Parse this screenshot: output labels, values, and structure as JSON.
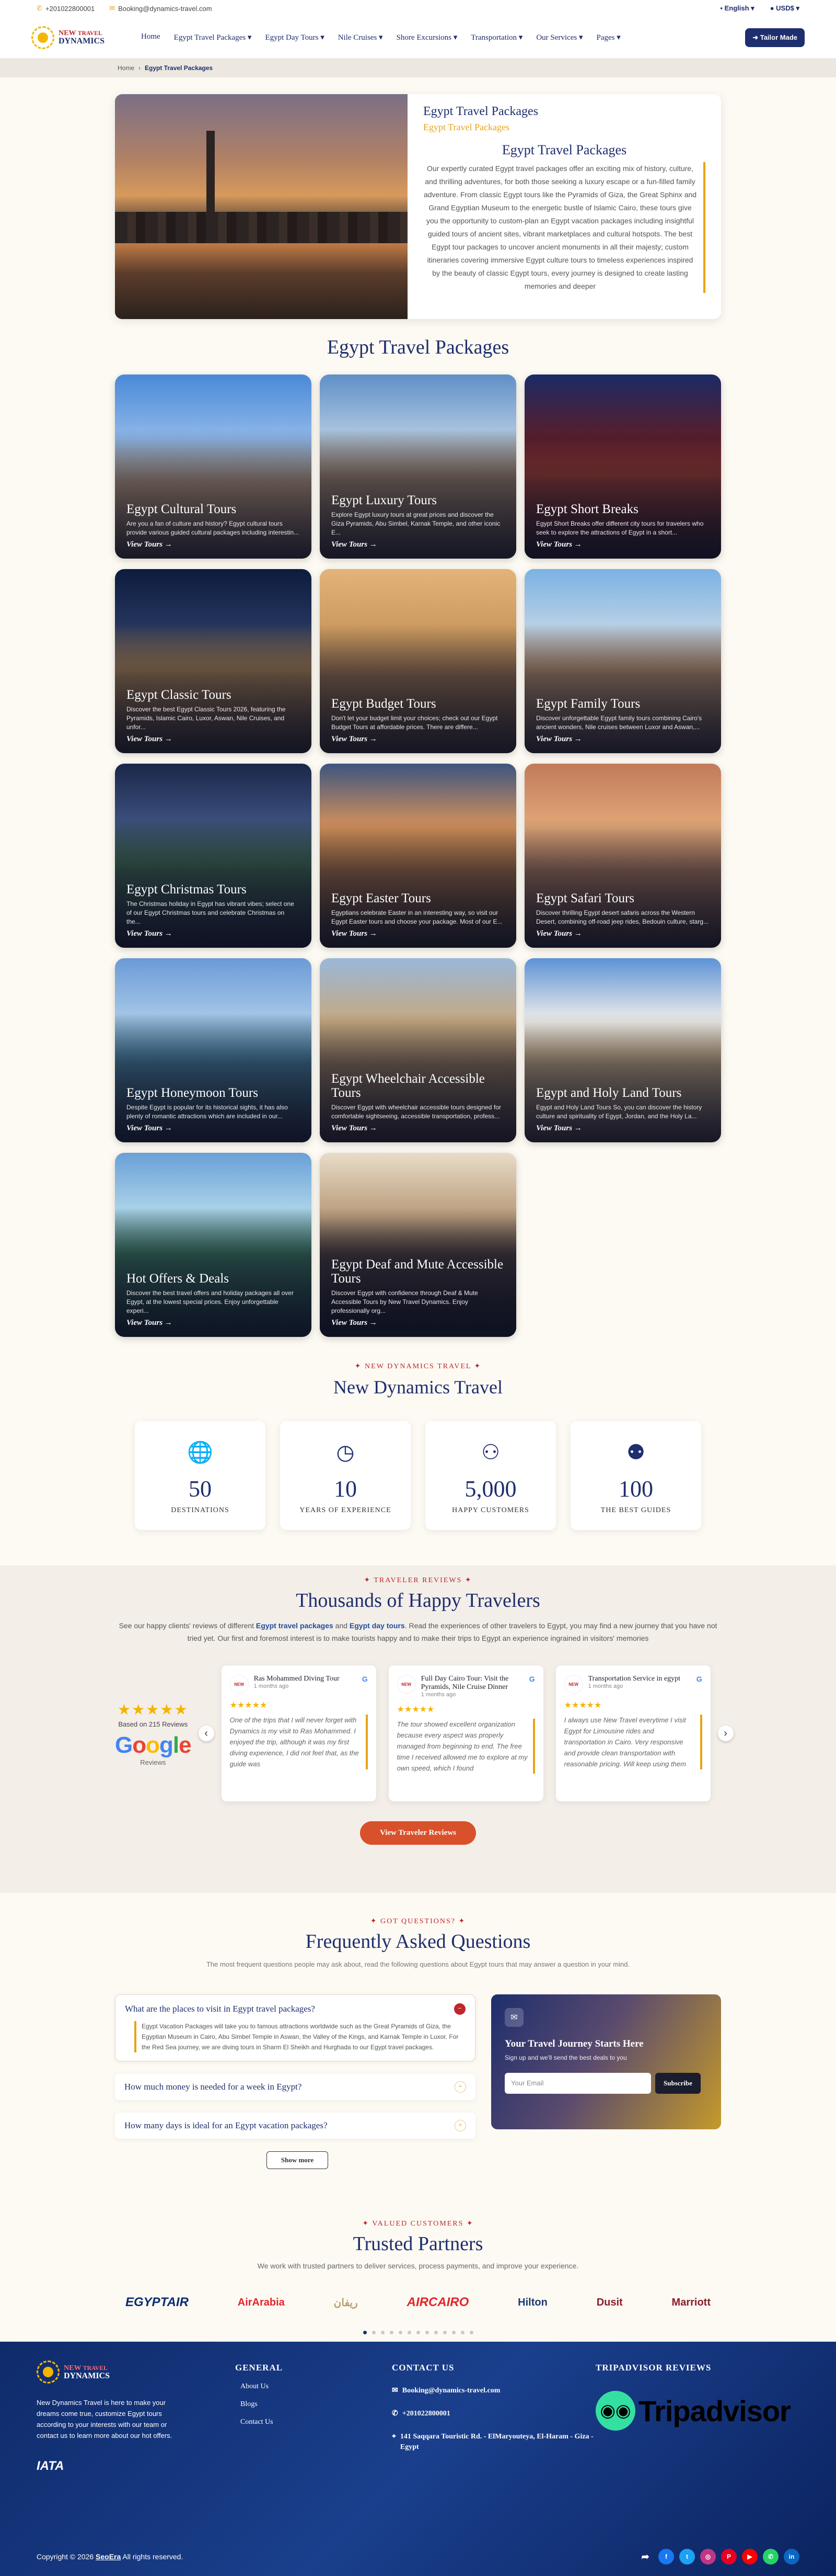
{
  "topbar": {
    "phone": "+201022800001",
    "email": "Booking@dynamics-travel.com",
    "language": "English",
    "currency": "USD$"
  },
  "logo": {
    "line1": "NEW",
    "line2": "TRAVEL",
    "line3": "DYNAMICS"
  },
  "nav": [
    "Home",
    "Egypt Travel Packages",
    "Egypt Day Tours",
    "Nile Cruises",
    "Shore Excursions",
    "Transportation",
    "Our Services",
    "Pages"
  ],
  "tailor_button": "Tailor Made",
  "breadcrumb": {
    "home": "Home",
    "current": "Egypt Travel Packages"
  },
  "intro": {
    "title": "Egypt Travel Packages",
    "subtitle": "Egypt Travel Packages",
    "heading": "Egypt Travel Packages",
    "text": "Our expertly curated Egypt travel packages offer an exciting mix of history, culture, and thrilling adventures, for both those seeking a luxury escape or a fun-filled family adventure. From classic Egypt tours like the Pyramids of Giza, the Great Sphinx and Grand Egyptian Museum to the energetic bustle of Islamic Cairo, these tours give you the opportunity to custom-plan an Egypt vacation packages including insightful guided tours of ancient sites, vibrant marketplaces and cultural hotspots. The best Egypt tour packages to uncover ancient monuments in all their majesty; custom itineraries covering immersive Egypt culture tours to timeless experiences inspired by the beauty of classic Egypt tours, every journey is designed to create lasting memories and deeper"
  },
  "packages_title": "Egypt Travel Packages",
  "view_label": "View Tours →",
  "packages": [
    {
      "title": "Egypt Cultural Tours",
      "desc": "Are you a fan of culture and history? Egypt cultural tours provide various guided cultural packages including interestin..."
    },
    {
      "title": "Egypt Luxury Tours",
      "desc": "Explore Egypt luxury tours at great prices and discover the Giza Pyramids, Abu Simbel, Karnak Temple, and other iconic E..."
    },
    {
      "title": "Egypt Short Breaks",
      "desc": "Egypt Short Breaks offer different city tours for travelers who seek to explore the attractions of Egypt in a short..."
    },
    {
      "title": "Egypt Classic Tours",
      "desc": "Discover the best Egypt Classic Tours 2026, featuring the Pyramids, Islamic Cairo, Luxor, Aswan, Nile Cruises, and unfor..."
    },
    {
      "title": "Egypt Budget Tours",
      "desc": "Don't let your budget limit your choices; check out our Egypt Budget Tours at affordable prices. There are differe..."
    },
    {
      "title": "Egypt Family Tours",
      "desc": "Discover unforgettable Egypt family tours combining Cairo's ancient wonders, Nile cruises between Luxor and Aswan,..."
    },
    {
      "title": "Egypt Christmas Tours",
      "desc": "The Christmas holiday in Egypt has vibrant vibes; select one of our Egypt Christmas tours and celebrate Christmas on the..."
    },
    {
      "title": "Egypt Easter Tours",
      "desc": "Egyptians celebrate Easter in an interesting way, so visit our Egypt Easter tours and choose your package. Most of our E..."
    },
    {
      "title": "Egypt Safari Tours",
      "desc": "Discover thrilling Egypt desert safaris across the Western Desert, combining off-road jeep rides, Bedouin culture, starg..."
    },
    {
      "title": "Egypt Honeymoon Tours",
      "desc": "Despite Egypt is popular for its historical sights, it has also plenty of romantic attractions which are included in our..."
    },
    {
      "title": "Egypt Wheelchair Accessible Tours",
      "desc": "Discover Egypt with wheelchair accessible tours designed for comfortable sightseeing, accessible transportation, profess..."
    },
    {
      "title": "Egypt and Holy Land Tours",
      "desc": "Egypt and Holy Land Tours So, you can discover the history culture and spirituality of Egypt, Jordan, and the Holy La..."
    },
    {
      "title": "Hot Offers & Deals",
      "desc": "Discover the best travel offers and holiday packages all over Egypt, at the lowest special prices. Enjoy unforgettable experi..."
    },
    {
      "title": "Egypt Deaf and Mute Accessible Tours",
      "desc": "Discover Egypt with confidence through Deaf & Mute Accessible Tours by New Travel Dynamics. Enjoy professionally org..."
    }
  ],
  "stats_section": {
    "kicker": "NEW DYNAMICS TRAVEL",
    "title": "New Dynamics Travel",
    "items": [
      {
        "icon": "globe-icon",
        "number": "50",
        "label": "DESTINATIONS"
      },
      {
        "icon": "clock-icon",
        "number": "10",
        "label": "YEARS OF EXPERIENCE"
      },
      {
        "icon": "user-icon",
        "number": "5,000",
        "label": "HAPPY CUSTOMERS"
      },
      {
        "icon": "users-icon",
        "number": "100",
        "label": "THE BEST GUIDES"
      }
    ]
  },
  "reviews": {
    "kicker": "TRAVELER REVIEWS",
    "title": "Thousands of Happy Travelers",
    "desc_part1": "See our happy clients' reviews of different",
    "desc_link1": "Egypt travel packages",
    "desc_and": "and",
    "desc_link2": "Egypt day tours",
    "desc_part2": ". Read the experiences of other travelers to Egypt, you may find a new journey that you have not tried yet. Our first and foremost interest is to make tourists happy and to make their trips to Egypt an experience ingrained in visitors' memories",
    "based_on": "Based on 215 Reviews",
    "google_reviews": "Reviews",
    "cards": [
      {
        "name": "Ras Mohammed Diving Tour",
        "ago": "1 months ago",
        "text": "One of the trips that I will never forget with Dynamics is my visit to Ras Mohammed. I enjoyed the trip, although it was my first diving experience, I did not feel that, as the guide was"
      },
      {
        "name": "Full Day Cairo Tour: Visit the Pyramids, Nile Cruise Dinner",
        "ago": "1 months ago",
        "text": "The tour showed excellent organization because every aspect was properly managed from beginning to end. The free time I received allowed me to explore at my own speed, which I found"
      },
      {
        "name": "Transportation Service in egypt",
        "ago": "1 months ago",
        "text": "I always use New Travel everytime I visit Egypt for Limousine rides and transportation in Cairo. Very responsive and provide clean transportation with reasonable pricing. Will keep using them"
      }
    ],
    "button": "View Traveler Reviews"
  },
  "faq": {
    "kicker": "GOT QUESTIONS?",
    "title": "Frequently Asked Questions",
    "desc": "The most frequent questions people may ask about, read the following questions about Egypt tours that may answer a question in your mind.",
    "items": [
      {
        "q": "What are the places to visit in Egypt travel packages?",
        "a": "Egypt Vacation Packages will take you to famous attractions worldwide such as the Great Pyramids of Giza, the Egyptian Museum in Cairo, Abu Simbel Temple in Aswan, the Valley of the Kings, and Karnak Temple in Luxor. For the Red Sea journey, we are diving tours in Sharm El Sheikh and Hurghada to our Egypt travel packages."
      },
      {
        "q": "How much money is needed for a week in Egypt?"
      },
      {
        "q": "How many days is ideal for an Egypt vacation packages?"
      }
    ],
    "show_more": "Show more"
  },
  "newsletter": {
    "title": "Your Travel Journey Starts Here",
    "desc": "Sign up and we'll send the best deals to you",
    "placeholder": "Your Email",
    "button": "Subscribe"
  },
  "partners": {
    "kicker": "VALUED CUSTOMERS",
    "title": "Trusted Partners",
    "desc": "We work with trusted partners to deliver services, process payments, and improve your experience.",
    "logos": [
      "EGYPTAIR",
      "AirArabia",
      "ريفان",
      "AIRCAIRO",
      "Hilton",
      "Dusit",
      "Marriott"
    ]
  },
  "footer": {
    "about": "New Dynamics Travel is here to make your dreams come true, customize Egypt tours according to your interests with our team or contact us to learn more about our hot offers.",
    "iata": "IATA",
    "general_title": "GENERAL",
    "general_links": [
      "About Us",
      "Blogs",
      "Contact Us"
    ],
    "contact_title": "CONTACT US",
    "contact_email": "Booking@dynamics-travel.com",
    "contact_phone": "+201022800001",
    "contact_address": "141 Saqqara Touristic Rd. - ElMaryouteya, El-Haram - Giza - Egypt",
    "tripadvisor_title": "TRIPADVISOR REVIEWS",
    "tripadvisor_text": "Tripadvisor",
    "copyright_pre": "Copyright © 2026",
    "copyright_link": "SeoEra",
    "copyright_post": "All rights reserved."
  }
}
